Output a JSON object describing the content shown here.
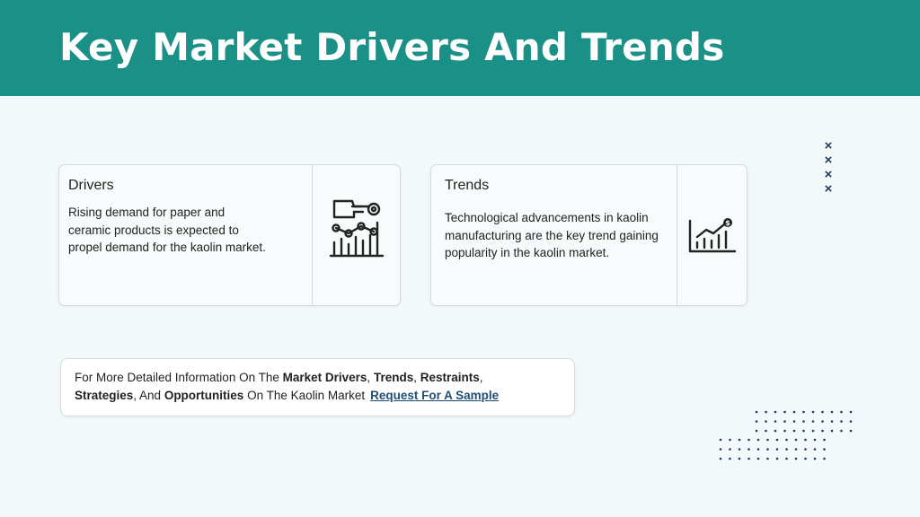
{
  "page": {
    "title": "Key Market Drivers And Trends",
    "header_color": "#1b9086"
  },
  "drivers": {
    "heading": "Drivers",
    "text": "Rising demand for paper and ceramic products is expected to propel demand for the kaolin market.",
    "icon": "hand-gear-chart-icon"
  },
  "trends": {
    "heading": "Trends",
    "text": "Technological advancements in kaolin manufacturing are the key trend gaining popularity in the kaolin market.",
    "icon": "dollar-growth-chart-icon"
  },
  "info": {
    "prefix": "For More Detailed Information On The ",
    "market_drivers": "Market Drivers",
    "sep1": ", ",
    "trends": "Trends",
    "sep2": ", ",
    "restraints": "Restraints",
    "sep3": ",",
    "strategies": "Strategies",
    "sep4": ", And ",
    "opportunities": "Opportunities",
    "suffix": " On The Kaolin Market",
    "cta": "Request For A Sample",
    "cta_color": "#1f4e79"
  },
  "decor": {
    "x_marks": [
      "×",
      "×",
      "×",
      "×"
    ],
    "x_color": "#1e3a5f"
  }
}
